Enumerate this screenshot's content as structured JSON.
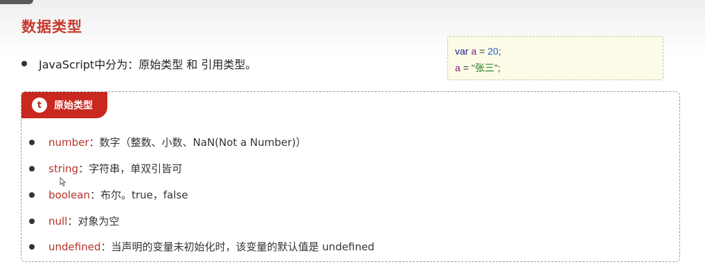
{
  "title": "数据类型",
  "intro": {
    "text": "JavaScript中分为：原始类型 和 引用类型。"
  },
  "code": {
    "line1": {
      "keyword": "var",
      "name": "a",
      "op": "=",
      "value": "20",
      "end": ";"
    },
    "line2": {
      "name": "a",
      "op": "=",
      "value": "\"张三\"",
      "end": ";"
    }
  },
  "panel": {
    "badge_icon": "t",
    "badge_label": "原始类型",
    "items": [
      {
        "term": "number",
        "desc": "：数字（整数、小数、NaN(Not a Number)）"
      },
      {
        "term": "string",
        "desc": "：字符串，单双引皆可"
      },
      {
        "term": "boolean",
        "desc": "：布尔。true，false"
      },
      {
        "term": "null",
        "desc": "：对象为空"
      },
      {
        "term": "undefined",
        "desc": "：当声明的变量未初始化时，该变量的默认值是 undefined"
      }
    ]
  },
  "colors": {
    "accent": "#c8281e",
    "title": "#c63a2e",
    "term": "#b53127",
    "code_background": "#fbfbe8"
  },
  "icons": {
    "badge": "t-circle-icon",
    "cursor": "mouse-pointer-icon"
  }
}
